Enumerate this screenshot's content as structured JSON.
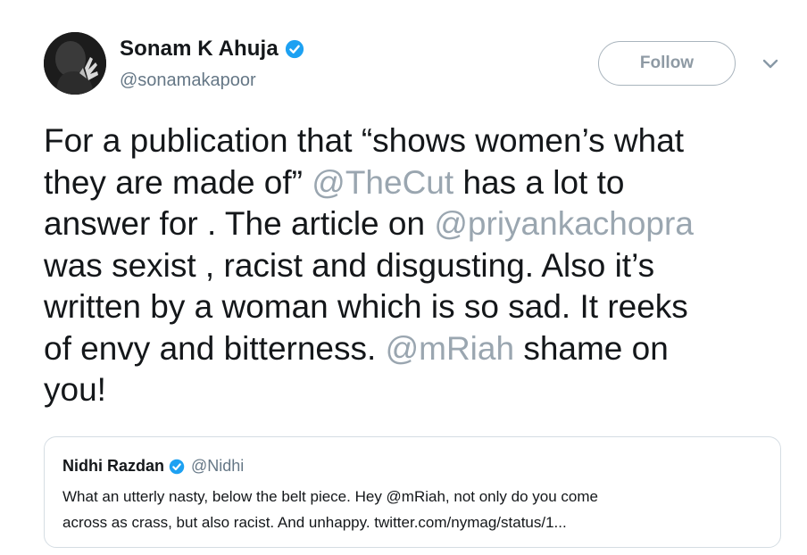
{
  "author": {
    "display_name": "Sonam K Ahuja",
    "handle": "@sonamakapoor",
    "verified_icon": "verified-badge-icon",
    "avatar_icon": "profile-avatar"
  },
  "follow_button": {
    "label": "Follow"
  },
  "menu": {
    "icon": "chevron-down-icon"
  },
  "tweet": {
    "lines": [
      [
        {
          "text": "For a publication that “shows women’s what",
          "mention": false
        }
      ],
      [
        {
          "text": "they are made of” ",
          "mention": false
        },
        {
          "text": "@TheCut",
          "mention": true
        },
        {
          "text": " has a lot to",
          "mention": false
        }
      ],
      [
        {
          "text": "answer for . The article on ",
          "mention": false
        },
        {
          "text": "@priyankachopra",
          "mention": true
        }
      ],
      [
        {
          "text": "was sexist , racist and disgusting. Also it’s",
          "mention": false
        }
      ],
      [
        {
          "text": "written by a woman which is so sad. It reeks",
          "mention": false
        }
      ],
      [
        {
          "text": "of envy and bitterness. ",
          "mention": false
        },
        {
          "text": "@mRiah",
          "mention": true
        },
        {
          "text": " shame on",
          "mention": false
        }
      ],
      [
        {
          "text": "you!",
          "mention": false
        }
      ]
    ]
  },
  "quoted_tweet": {
    "display_name": "Nidhi Razdan",
    "handle": "@Nidhi",
    "lines": [
      "What an utterly nasty, below the belt piece. Hey @mRiah, not only do you come",
      "across as crass, but also racist. And unhappy. twitter.com/nymag/status/1..."
    ]
  },
  "colors": {
    "text": "#14171a",
    "secondary": "#657786",
    "mention": "#9aa6b0",
    "verified": "#1da1f2",
    "border": "#d5dde3"
  }
}
